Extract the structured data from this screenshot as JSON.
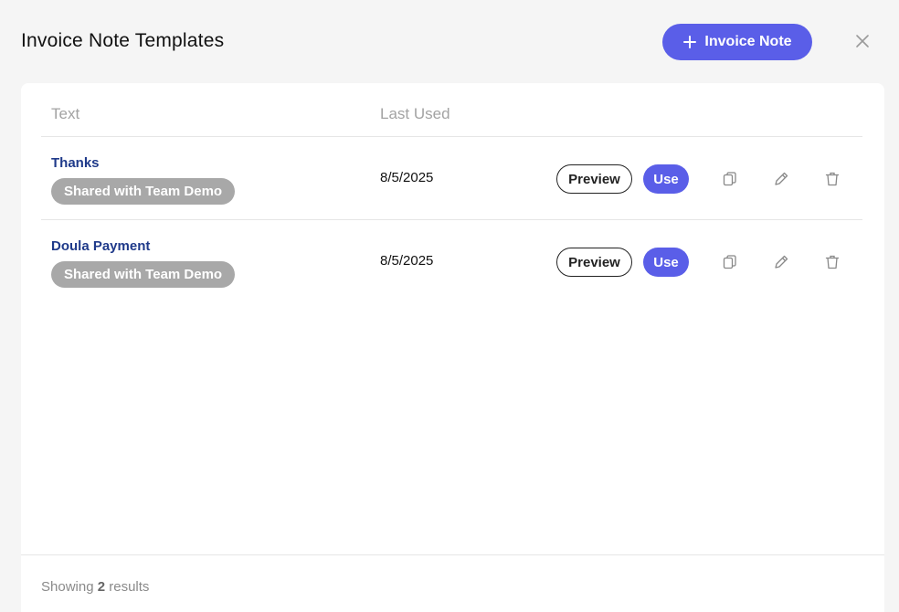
{
  "header": {
    "title": "Invoice Note Templates",
    "add_button_label": "Invoice Note",
    "add_icon": "plus-icon",
    "close_icon": "close-icon"
  },
  "table": {
    "columns": [
      "Text",
      "Last Used"
    ],
    "rows": [
      {
        "name": "Thanks",
        "badge": "Shared with Team Demo",
        "last_used": "8/5/2025",
        "preview_label": "Preview",
        "use_label": "Use"
      },
      {
        "name": "Doula Payment",
        "badge": "Shared with Team Demo",
        "last_used": "8/5/2025",
        "preview_label": "Preview",
        "use_label": "Use"
      }
    ],
    "row_actions": [
      "copy-icon",
      "pencil-icon",
      "trash-icon"
    ]
  },
  "footer": {
    "prefix": "Showing",
    "count": "2",
    "suffix": "results"
  },
  "colors": {
    "accent": "#5a5ee8",
    "link": "#1f3a8a",
    "badge": "#a8a8a8"
  }
}
